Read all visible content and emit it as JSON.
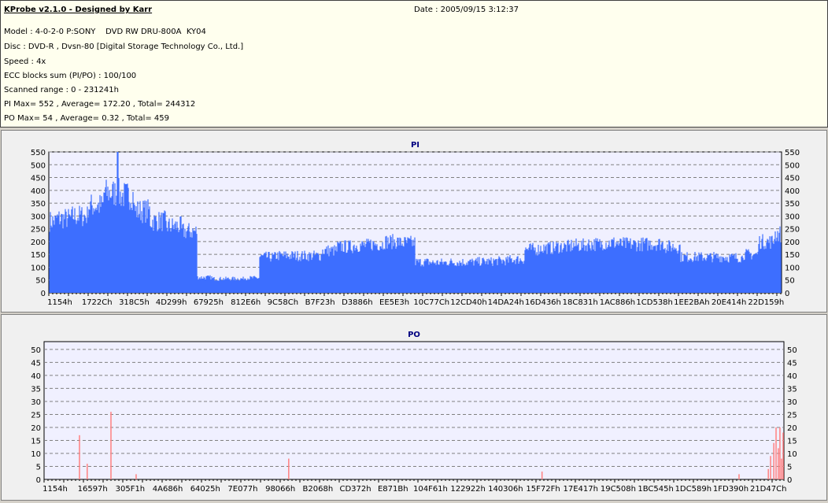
{
  "header": {
    "title": "KProbe v2.1.0 - Designed by Karr",
    "date": "Date : 2005/09/15 3:12:37",
    "lines": [
      "Model : 4-0-2-0 P:SONY    DVD RW DRU-800A  KY04",
      "Disc : DVD-R , Dvsn-80 [Digital Storage Technology Co., Ltd.]",
      "Speed : 4x",
      "ECC blocks sum (PI/PO) : 100/100",
      "Scanned range : 0 - 231241h",
      "PI Max= 552 , Average= 172.20 , Total= 244312",
      "PO Max= 54 , Average= 0.32 , Total= 459"
    ]
  },
  "colors": {
    "pi": "#3d6eff",
    "po": "#ff8080",
    "plot_bg": "#f0f0ff",
    "title": "#000080"
  },
  "chart_data": [
    {
      "type": "bar",
      "title": "PI",
      "ylim": [
        0,
        550
      ],
      "yticks": [
        0,
        50,
        100,
        150,
        200,
        250,
        300,
        350,
        400,
        450,
        500,
        550
      ],
      "xticks": [
        "1154h",
        "1722Ch",
        "318C5h",
        "4D299h",
        "67925h",
        "812E6h",
        "9C58Ch",
        "B7F23h",
        "D3886h",
        "EE5E3h",
        "10C77Ch",
        "12CD40h",
        "14DA24h",
        "16D436h",
        "18C831h",
        "1AC886h",
        "1CD538h",
        "1EE2BAh",
        "20E414h",
        "22D159h"
      ],
      "profile": [
        280,
        290,
        300,
        340,
        390,
        380,
        320,
        280,
        260,
        240,
        60,
        55,
        55,
        58,
        140,
        145,
        145,
        145,
        165,
        180,
        185,
        190,
        200,
        195,
        120,
        118,
        120,
        120,
        122,
        125,
        130,
        170,
        175,
        180,
        185,
        190,
        195,
        190,
        190,
        192,
        180,
        140,
        140,
        140,
        138,
        150,
        200,
        230
      ],
      "max": 552,
      "max_at_fraction_of_profile": 0.094
    },
    {
      "type": "bar",
      "title": "PO",
      "ylim": [
        0,
        53
      ],
      "yticks": [
        0,
        5,
        10,
        15,
        20,
        25,
        30,
        35,
        40,
        45,
        50
      ],
      "xticks": [
        "1154h",
        "16597h",
        "305F1h",
        "4A686h",
        "64025h",
        "7E077h",
        "98066h",
        "B2068h",
        "CD372h",
        "E871Bh",
        "104F61h",
        "122922h",
        "140306h",
        "15F72Fh",
        "17E417h",
        "19C508h",
        "1BC545h",
        "1DC589h",
        "1FD390h",
        "21D47Ch"
      ],
      "xrange": [
        0,
        2298433
      ],
      "spikes": [
        [
          110000,
          17
        ],
        [
          134000,
          6
        ],
        [
          207800,
          26
        ],
        [
          286000,
          2
        ],
        [
          760000,
          8
        ],
        [
          1547000,
          3
        ],
        [
          2159000,
          2
        ],
        [
          2250000,
          4
        ],
        [
          2257000,
          9
        ],
        [
          2267000,
          14
        ],
        [
          2274000,
          20
        ],
        [
          2281000,
          12
        ],
        [
          2286000,
          20
        ],
        [
          2291000,
          8
        ],
        [
          2296000,
          18
        ]
      ]
    }
  ]
}
